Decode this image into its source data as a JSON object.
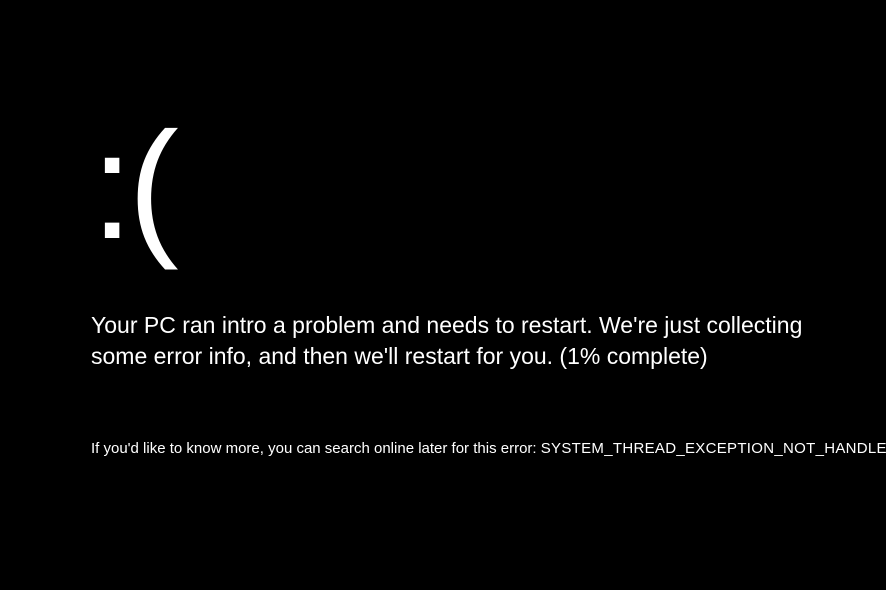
{
  "emoticon": ":(",
  "message_line1": "Your PC ran intro a problem and needs to restart. We're just collecting",
  "message_line2": "some error info, and then we'll restart for you. (1% complete)",
  "search_prompt": "If you'd like to know more, you can search online later for this error: ",
  "error_code": "SYSTEM_THREAD_EXCEPTION_NOT_HANDLED"
}
